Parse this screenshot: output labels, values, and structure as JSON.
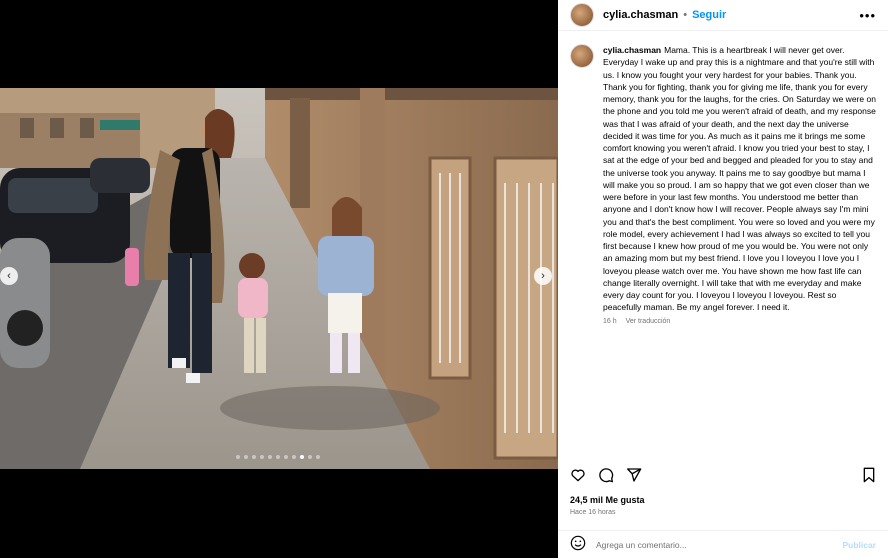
{
  "post": {
    "username": "cylia.chasman",
    "separator": "•",
    "follow_label": "Seguir",
    "more_label": "•••",
    "caption_username": "cylia.chasman",
    "caption": "Mama. This is a heartbreak I will never get over. Everyday I wake up and pray this is a nightmare and that you're still with us. I know you fought your very hardest for your babies. Thank you. Thank you for fighting, thank you for giving me life, thank you for every memory, thank you for the laughs, for the cries. On Saturday we were on the phone and you told me you weren't afraid of death, and my response was that I was afraid of your death, and the next day the universe decided it was time for you. As much as it pains me it brings me some comfort knowing you weren't afraid. I know you tried your best to stay, I sat at the edge of your bed and begged and pleaded for you to stay and the universe took you anyway. It pains me to say goodbye but mama I will make you so proud. I am so happy that we got even closer than we were before in your last few months. You understood me better than anyone and I don't know how I will recover. People always say I'm mini you and that's the best compliment. You were so loved and you were my role model, every achievement I had I was always so excited to tell you first because I knew how proud of me you would be. You were not only an amazing mom but my best friend. I love you I loveyou I love you I loveyou please watch over me. You have shown me how fast life can change literally overnight. I will take that with me everyday and make every day count for you. I loveyou I loveyou I loveyou. Rest so peacefully maman. Be my angel forever. I need it.",
    "caption_age": "16 h",
    "translate_label": "Ver traducción",
    "likes": "24,5 mil Me gusta",
    "posted_time": "Hace 16 horas",
    "comment_placeholder": "Agrega un comentario...",
    "publish_label": "Publicar"
  },
  "carousel": {
    "prev_label": "‹",
    "next_label": "›",
    "slide_count": 11,
    "active_slide": 9
  },
  "icons": {
    "like": "heart-icon",
    "comment": "comment-bubble-icon",
    "share": "paper-plane-icon",
    "save": "bookmark-icon",
    "emoji": "emoji-icon",
    "more": "more-options-icon"
  },
  "colors": {
    "accent": "#0095f6",
    "muted": "#737373",
    "publish_disabled": "#b2dffc"
  }
}
